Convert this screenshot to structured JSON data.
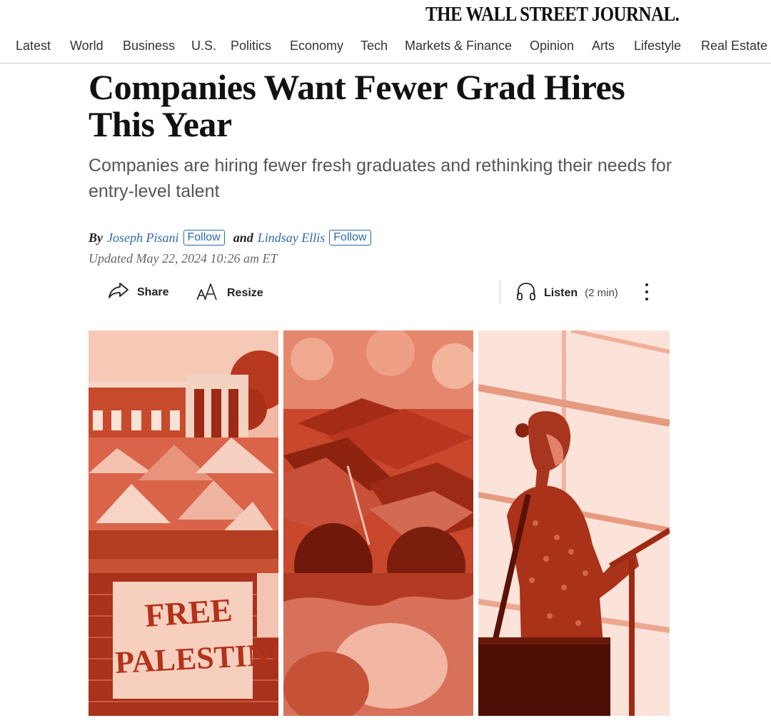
{
  "masthead": {
    "logo": "THE WALL STREET JOURNAL."
  },
  "nav": {
    "items": [
      "Latest",
      "World",
      "Business",
      "U.S.",
      "Politics",
      "Economy",
      "Tech",
      "Markets & Finance",
      "Opinion",
      "Arts",
      "Lifestyle",
      "Real Estate"
    ]
  },
  "article": {
    "headline": "Companies Want Fewer Grad Hires This Year",
    "dek": "Companies are hiring fewer fresh graduates and rethinking their needs for entry-level talent",
    "byline": {
      "by": "By",
      "author1": "Joseph Pisani",
      "and": "and",
      "author2": "Lindsay Ellis",
      "follow": "Follow"
    },
    "updated": "Updated May 22, 2024 10:26 am ET"
  },
  "toolbar": {
    "share": "Share",
    "resize": "Resize",
    "listen": "Listen",
    "listen_duration": "(2 min)"
  },
  "hero": {
    "sign_line1": "FREE",
    "sign_line2": "PALESTINE",
    "tint_color": "#e0553a"
  }
}
